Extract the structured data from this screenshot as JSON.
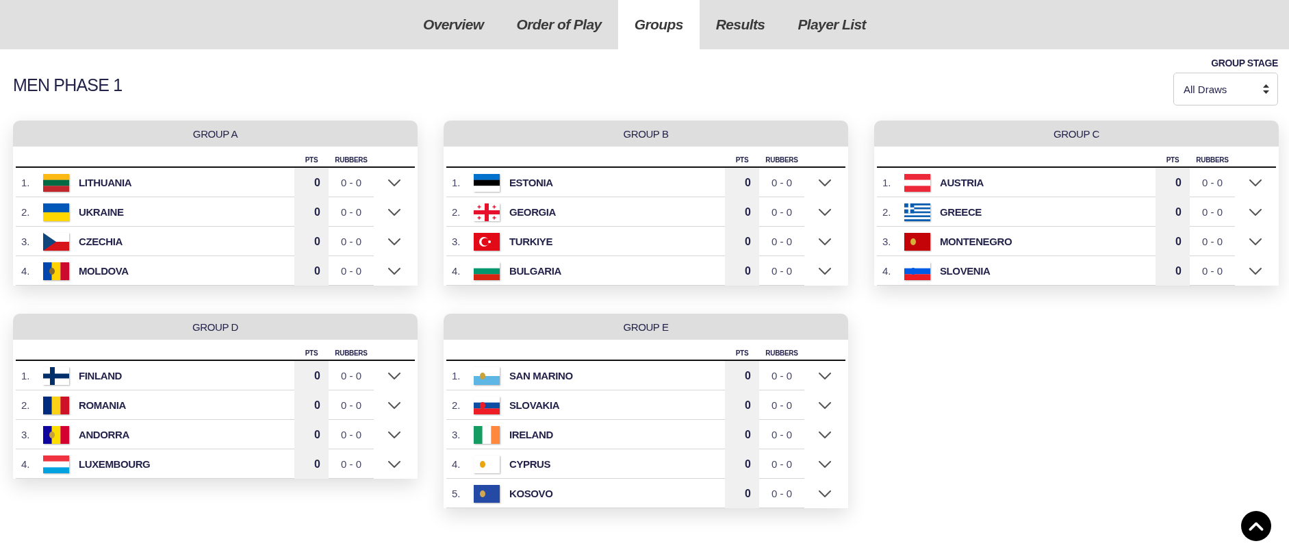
{
  "tabs": [
    {
      "label": "Overview",
      "selected": false
    },
    {
      "label": "Order of Play",
      "selected": false
    },
    {
      "label": "Groups",
      "selected": true
    },
    {
      "label": "Results",
      "selected": false
    },
    {
      "label": "Player List",
      "selected": false
    }
  ],
  "title": "MEN PHASE 1",
  "stage_filter": {
    "label": "GROUP STAGE",
    "value": "All Draws"
  },
  "groups": [
    {
      "name": "GROUP A",
      "columns": [
        "PTS",
        "RUBBERS"
      ],
      "teams": [
        {
          "rank": "1.",
          "name": "LITHUANIA",
          "pts": "0",
          "rubbers": "0 - 0"
        },
        {
          "rank": "2.",
          "name": "UKRAINE",
          "pts": "0",
          "rubbers": "0 - 0"
        },
        {
          "rank": "3.",
          "name": "CZECHIA",
          "pts": "0",
          "rubbers": "0 - 0"
        },
        {
          "rank": "4.",
          "name": "MOLDOVA",
          "pts": "0",
          "rubbers": "0 - 0"
        }
      ]
    },
    {
      "name": "GROUP B",
      "columns": [
        "PTS",
        "RUBBERS"
      ],
      "teams": [
        {
          "rank": "1.",
          "name": "ESTONIA",
          "pts": "0",
          "rubbers": "0 - 0"
        },
        {
          "rank": "2.",
          "name": "GEORGIA",
          "pts": "0",
          "rubbers": "0 - 0"
        },
        {
          "rank": "3.",
          "name": "TURKIYE",
          "pts": "0",
          "rubbers": "0 - 0"
        },
        {
          "rank": "4.",
          "name": "BULGARIA",
          "pts": "0",
          "rubbers": "0 - 0"
        }
      ]
    },
    {
      "name": "GROUP C",
      "columns": [
        "PTS",
        "RUBBERS"
      ],
      "teams": [
        {
          "rank": "1.",
          "name": "AUSTRIA",
          "pts": "0",
          "rubbers": "0 - 0"
        },
        {
          "rank": "2.",
          "name": "GREECE",
          "pts": "0",
          "rubbers": "0 - 0"
        },
        {
          "rank": "3.",
          "name": "MONTENEGRO",
          "pts": "0",
          "rubbers": "0 - 0"
        },
        {
          "rank": "4.",
          "name": "SLOVENIA",
          "pts": "0",
          "rubbers": "0 - 0"
        }
      ]
    },
    {
      "name": "GROUP D",
      "columns": [
        "PTS",
        "RUBBERS"
      ],
      "teams": [
        {
          "rank": "1.",
          "name": "FINLAND",
          "pts": "0",
          "rubbers": "0 - 0"
        },
        {
          "rank": "2.",
          "name": "ROMANIA",
          "pts": "0",
          "rubbers": "0 - 0"
        },
        {
          "rank": "3.",
          "name": "ANDORRA",
          "pts": "0",
          "rubbers": "0 - 0"
        },
        {
          "rank": "4.",
          "name": "LUXEMBOURG",
          "pts": "0",
          "rubbers": "0 - 0"
        }
      ]
    },
    {
      "name": "GROUP E",
      "columns": [
        "PTS",
        "RUBBERS"
      ],
      "teams": [
        {
          "rank": "1.",
          "name": "SAN MARINO",
          "pts": "0",
          "rubbers": "0 - 0"
        },
        {
          "rank": "2.",
          "name": "SLOVAKIA",
          "pts": "0",
          "rubbers": "0 - 0"
        },
        {
          "rank": "3.",
          "name": "IRELAND",
          "pts": "0",
          "rubbers": "0 - 0"
        },
        {
          "rank": "4.",
          "name": "CYPRUS",
          "pts": "0",
          "rubbers": "0 - 0"
        },
        {
          "rank": "5.",
          "name": "KOSOVO",
          "pts": "0",
          "rubbers": "0 - 0"
        }
      ]
    }
  ]
}
